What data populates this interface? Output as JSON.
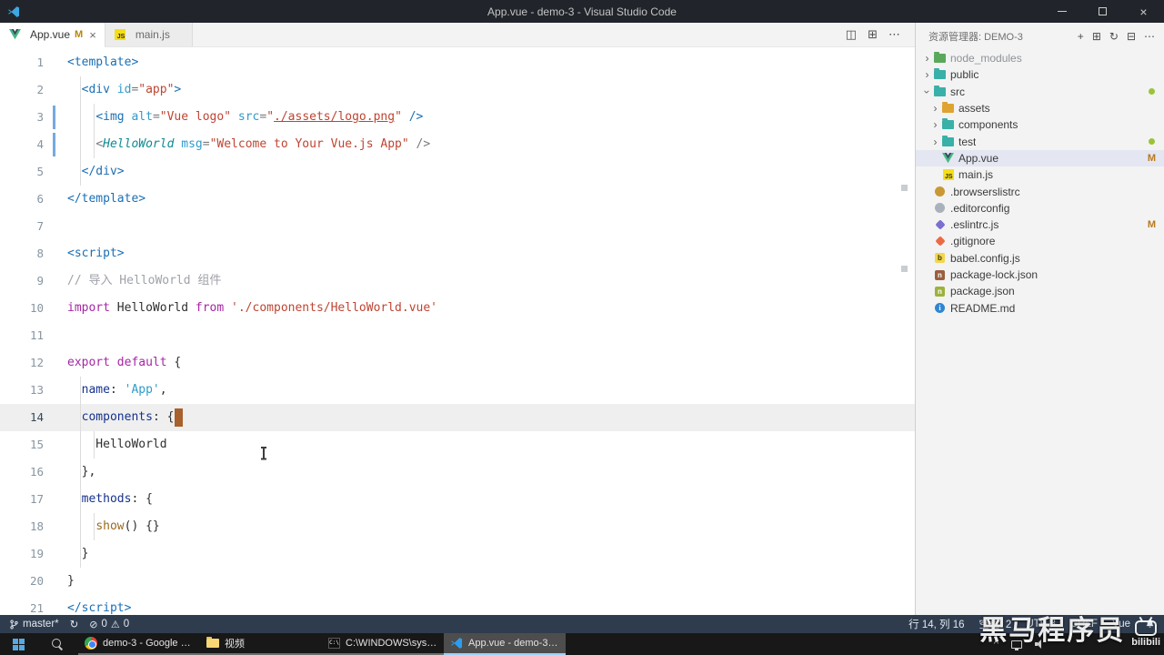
{
  "title_bar": {
    "title": "App.vue - demo-3 - Visual Studio Code"
  },
  "tab_bar": {
    "tabs": [
      {
        "label": "App.vue",
        "icon": "vue",
        "badge": "M",
        "close": "×",
        "active": true
      },
      {
        "label": "main.js",
        "icon": "js",
        "badge": "",
        "close": "",
        "active": false
      }
    ],
    "actions": [
      {
        "name": "split-editor-icon",
        "glyph": "◫"
      },
      {
        "name": "layout-icon",
        "glyph": "⊞"
      },
      {
        "name": "more-actions-icon",
        "glyph": "⋯"
      }
    ]
  },
  "editor": {
    "cursor_line": 14,
    "cursor_col": 16,
    "lines": [
      {
        "n": "1",
        "tokens": [
          {
            "t": "<template>",
            "c": "tag"
          }
        ]
      },
      {
        "n": "2",
        "tokens": [
          {
            "t": "  ",
            "c": "pln"
          },
          {
            "t": "<div ",
            "c": "tag"
          },
          {
            "t": "id",
            "c": "attr"
          },
          {
            "t": "=",
            "c": "pun"
          },
          {
            "t": "\"app\"",
            "c": "str"
          },
          {
            "t": ">",
            "c": "tag"
          }
        ]
      },
      {
        "n": "3",
        "gutter": "mod",
        "tokens": [
          {
            "t": "    ",
            "c": "pln"
          },
          {
            "t": "<img ",
            "c": "tag"
          },
          {
            "t": "alt",
            "c": "attr"
          },
          {
            "t": "=",
            "c": "pun"
          },
          {
            "t": "\"Vue logo\"",
            "c": "str"
          },
          {
            "t": " ",
            "c": "pln"
          },
          {
            "t": "src",
            "c": "attr"
          },
          {
            "t": "=",
            "c": "pun"
          },
          {
            "t": "\"",
            "c": "str"
          },
          {
            "t": "./assets/logo.png",
            "c": "str lnk"
          },
          {
            "t": "\"",
            "c": "str"
          },
          {
            "t": " />",
            "c": "tag"
          }
        ]
      },
      {
        "n": "4",
        "gutter": "mod",
        "tokens": [
          {
            "t": "    ",
            "c": "pln"
          },
          {
            "t": "<",
            "c": "pun"
          },
          {
            "t": "HelloWorld",
            "c": "cmp"
          },
          {
            "t": " ",
            "c": "pln"
          },
          {
            "t": "msg",
            "c": "attr"
          },
          {
            "t": "=",
            "c": "pun"
          },
          {
            "t": "\"Welcome to Your Vue.js App\"",
            "c": "str"
          },
          {
            "t": " />",
            "c": "pun"
          }
        ]
      },
      {
        "n": "5",
        "tokens": [
          {
            "t": "  ",
            "c": "pln"
          },
          {
            "t": "</div>",
            "c": "tag"
          }
        ]
      },
      {
        "n": "6",
        "tokens": [
          {
            "t": "</template>",
            "c": "tag"
          }
        ]
      },
      {
        "n": "7",
        "tokens": []
      },
      {
        "n": "8",
        "tokens": [
          {
            "t": "<script>",
            "c": "tag"
          }
        ]
      },
      {
        "n": "9",
        "tokens": [
          {
            "t": "// 导入 HelloWorld 组件",
            "c": "com"
          }
        ]
      },
      {
        "n": "10",
        "tokens": [
          {
            "t": "import",
            "c": "kw"
          },
          {
            "t": " HelloWorld ",
            "c": "pln"
          },
          {
            "t": "from",
            "c": "kw"
          },
          {
            "t": " ",
            "c": "pln"
          },
          {
            "t": "'./components/HelloWorld.vue'",
            "c": "str"
          }
        ]
      },
      {
        "n": "11",
        "tokens": []
      },
      {
        "n": "12",
        "tokens": [
          {
            "t": "export",
            "c": "kw"
          },
          {
            "t": " ",
            "c": "pln"
          },
          {
            "t": "default",
            "c": "kw"
          },
          {
            "t": " {",
            "c": "pln"
          }
        ]
      },
      {
        "n": "13",
        "tokens": [
          {
            "t": "  ",
            "c": "pln"
          },
          {
            "t": "name",
            "c": "prop"
          },
          {
            "t": ": ",
            "c": "pln"
          },
          {
            "t": "'App'",
            "c": "str2"
          },
          {
            "t": ",",
            "c": "pln"
          }
        ]
      },
      {
        "n": "14",
        "current": true,
        "tokens": [
          {
            "t": "  ",
            "c": "pln"
          },
          {
            "t": "components",
            "c": "prop"
          },
          {
            "t": ": {",
            "c": "pln"
          },
          {
            "t": "",
            "c": "cursor"
          }
        ]
      },
      {
        "n": "15",
        "tokens": [
          {
            "t": "    HelloWorld",
            "c": "pln"
          }
        ]
      },
      {
        "n": "16",
        "tokens": [
          {
            "t": "  },",
            "c": "pln"
          }
        ]
      },
      {
        "n": "17",
        "tokens": [
          {
            "t": "  ",
            "c": "pln"
          },
          {
            "t": "methods",
            "c": "prop"
          },
          {
            "t": ": {",
            "c": "pln"
          }
        ]
      },
      {
        "n": "18",
        "tokens": [
          {
            "t": "    ",
            "c": "pln"
          },
          {
            "t": "show",
            "c": "fn"
          },
          {
            "t": "() {}",
            "c": "pln"
          }
        ]
      },
      {
        "n": "19",
        "tokens": [
          {
            "t": "  }",
            "c": "pln"
          }
        ]
      },
      {
        "n": "20",
        "tokens": [
          {
            "t": "}",
            "c": "pln"
          }
        ]
      },
      {
        "n": "21",
        "tokens": [
          {
            "t": "</script>",
            "c": "tag"
          }
        ]
      }
    ]
  },
  "explorer": {
    "header": "资源管理器: DEMO-3",
    "actions": [
      {
        "name": "new-file-icon",
        "glyph": "+"
      },
      {
        "name": "new-folder-icon",
        "glyph": "⊞"
      },
      {
        "name": "refresh-icon",
        "glyph": "↻"
      },
      {
        "name": "collapse-folders-icon",
        "glyph": "⊟"
      },
      {
        "name": "more-actions-icon",
        "glyph": "⋯"
      }
    ],
    "tree": [
      {
        "label": "node_modules",
        "depth": 0,
        "chevron": "closed",
        "icon": "folder",
        "color": "#5aa85c",
        "dim": true
      },
      {
        "label": "public",
        "depth": 0,
        "chevron": "closed",
        "icon": "folder",
        "color": "#39b0a8"
      },
      {
        "label": "src",
        "depth": 0,
        "chevron": "open",
        "icon": "folder",
        "color": "#39b0a8",
        "dot": true
      },
      {
        "label": "assets",
        "depth": 1,
        "chevron": "closed",
        "icon": "folder",
        "color": "#dfa32f"
      },
      {
        "label": "components",
        "depth": 1,
        "chevron": "closed",
        "icon": "folder",
        "color": "#39b0a8"
      },
      {
        "label": "test",
        "depth": 1,
        "chevron": "closed",
        "icon": "folder",
        "color": "#39b0a8",
        "dot": true
      },
      {
        "label": "App.vue",
        "depth": 1,
        "icon": "vue",
        "badge": "M",
        "selected": true
      },
      {
        "label": "main.js",
        "depth": 1,
        "icon": "js"
      },
      {
        "label": ".browserslistrc",
        "depth": 0,
        "icon": "browserslist"
      },
      {
        "label": ".editorconfig",
        "depth": 0,
        "icon": "editorconfig"
      },
      {
        "label": ".eslintrc.js",
        "depth": 0,
        "icon": "eslint",
        "badge": "M"
      },
      {
        "label": ".gitignore",
        "depth": 0,
        "icon": "git"
      },
      {
        "label": "babel.config.js",
        "depth": 0,
        "icon": "babel"
      },
      {
        "label": "package-lock.json",
        "depth": 0,
        "icon": "npm-lock"
      },
      {
        "label": "package.json",
        "depth": 0,
        "icon": "npm"
      },
      {
        "label": "README.md",
        "depth": 0,
        "icon": "info"
      }
    ]
  },
  "status_bar": {
    "branch": "master*",
    "errors": "0",
    "warnings": "0",
    "line_col": "行 14, 列 16",
    "spaces": "空格: 2",
    "encoding": "UTF-8",
    "eol": "CRLF",
    "lang": "Vue"
  },
  "taskbar": {
    "buttons": [
      {
        "label": "demo-3 - Google C...",
        "icon": "chrome",
        "active": false
      },
      {
        "label": "视频",
        "icon": "folder-win",
        "active": false
      },
      {
        "label": "C:\\WINDOWS\\syste...",
        "icon": "cmd",
        "active": false
      },
      {
        "label": "App.vue - demo-3 -...",
        "icon": "vscode",
        "active": true
      }
    ],
    "tray": [
      "tray-expand-icon",
      "network-icon",
      "volume-icon"
    ]
  },
  "watermark": {
    "text": "黑马程序员",
    "brand": "bilibili"
  }
}
